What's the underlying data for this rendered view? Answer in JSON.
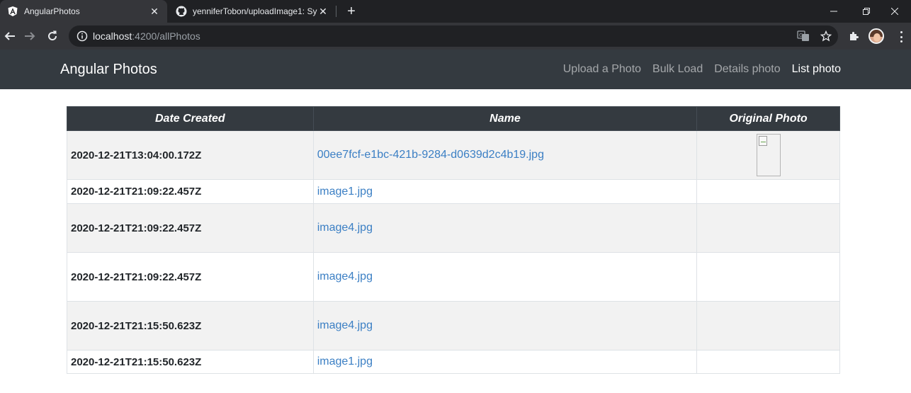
{
  "browser": {
    "tabs": [
      {
        "title": "AngularPhotos",
        "active": true,
        "icon": "angular-icon"
      },
      {
        "title": "yenniferTobon/uploadImage1: Sy",
        "active": false,
        "icon": "github-icon"
      }
    ],
    "url_host": "localhost",
    "url_path": ":4200/allPhotos"
  },
  "app": {
    "brand": "Angular Photos",
    "nav": [
      {
        "label": "Upload a Photo",
        "active": false
      },
      {
        "label": "Bulk Load",
        "active": false
      },
      {
        "label": "Details photo",
        "active": false
      },
      {
        "label": "List photo",
        "active": true
      }
    ]
  },
  "table": {
    "headers": [
      "Date Created",
      "Name",
      "Original Photo"
    ],
    "rows": [
      {
        "date": "2020-12-21T13:04:00.172Z",
        "name": "00ee7fcf-e1bc-421b-9284-d0639d2c4b19.jpg",
        "has_photo": true
      },
      {
        "date": "2020-12-21T21:09:22.457Z",
        "name": "image1.jpg",
        "has_photo": false
      },
      {
        "date": "2020-12-21T21:09:22.457Z",
        "name": "image4.jpg",
        "has_photo": false
      },
      {
        "date": "2020-12-21T21:09:22.457Z",
        "name": "image4.jpg",
        "has_photo": false
      },
      {
        "date": "2020-12-21T21:15:50.623Z",
        "name": "image4.jpg",
        "has_photo": false
      },
      {
        "date": "2020-12-21T21:15:50.623Z",
        "name": "image1.jpg",
        "has_photo": false
      }
    ]
  },
  "colors": {
    "navbar": "#343a40",
    "link": "#3b7fc4",
    "stripe": "#f2f2f2"
  }
}
